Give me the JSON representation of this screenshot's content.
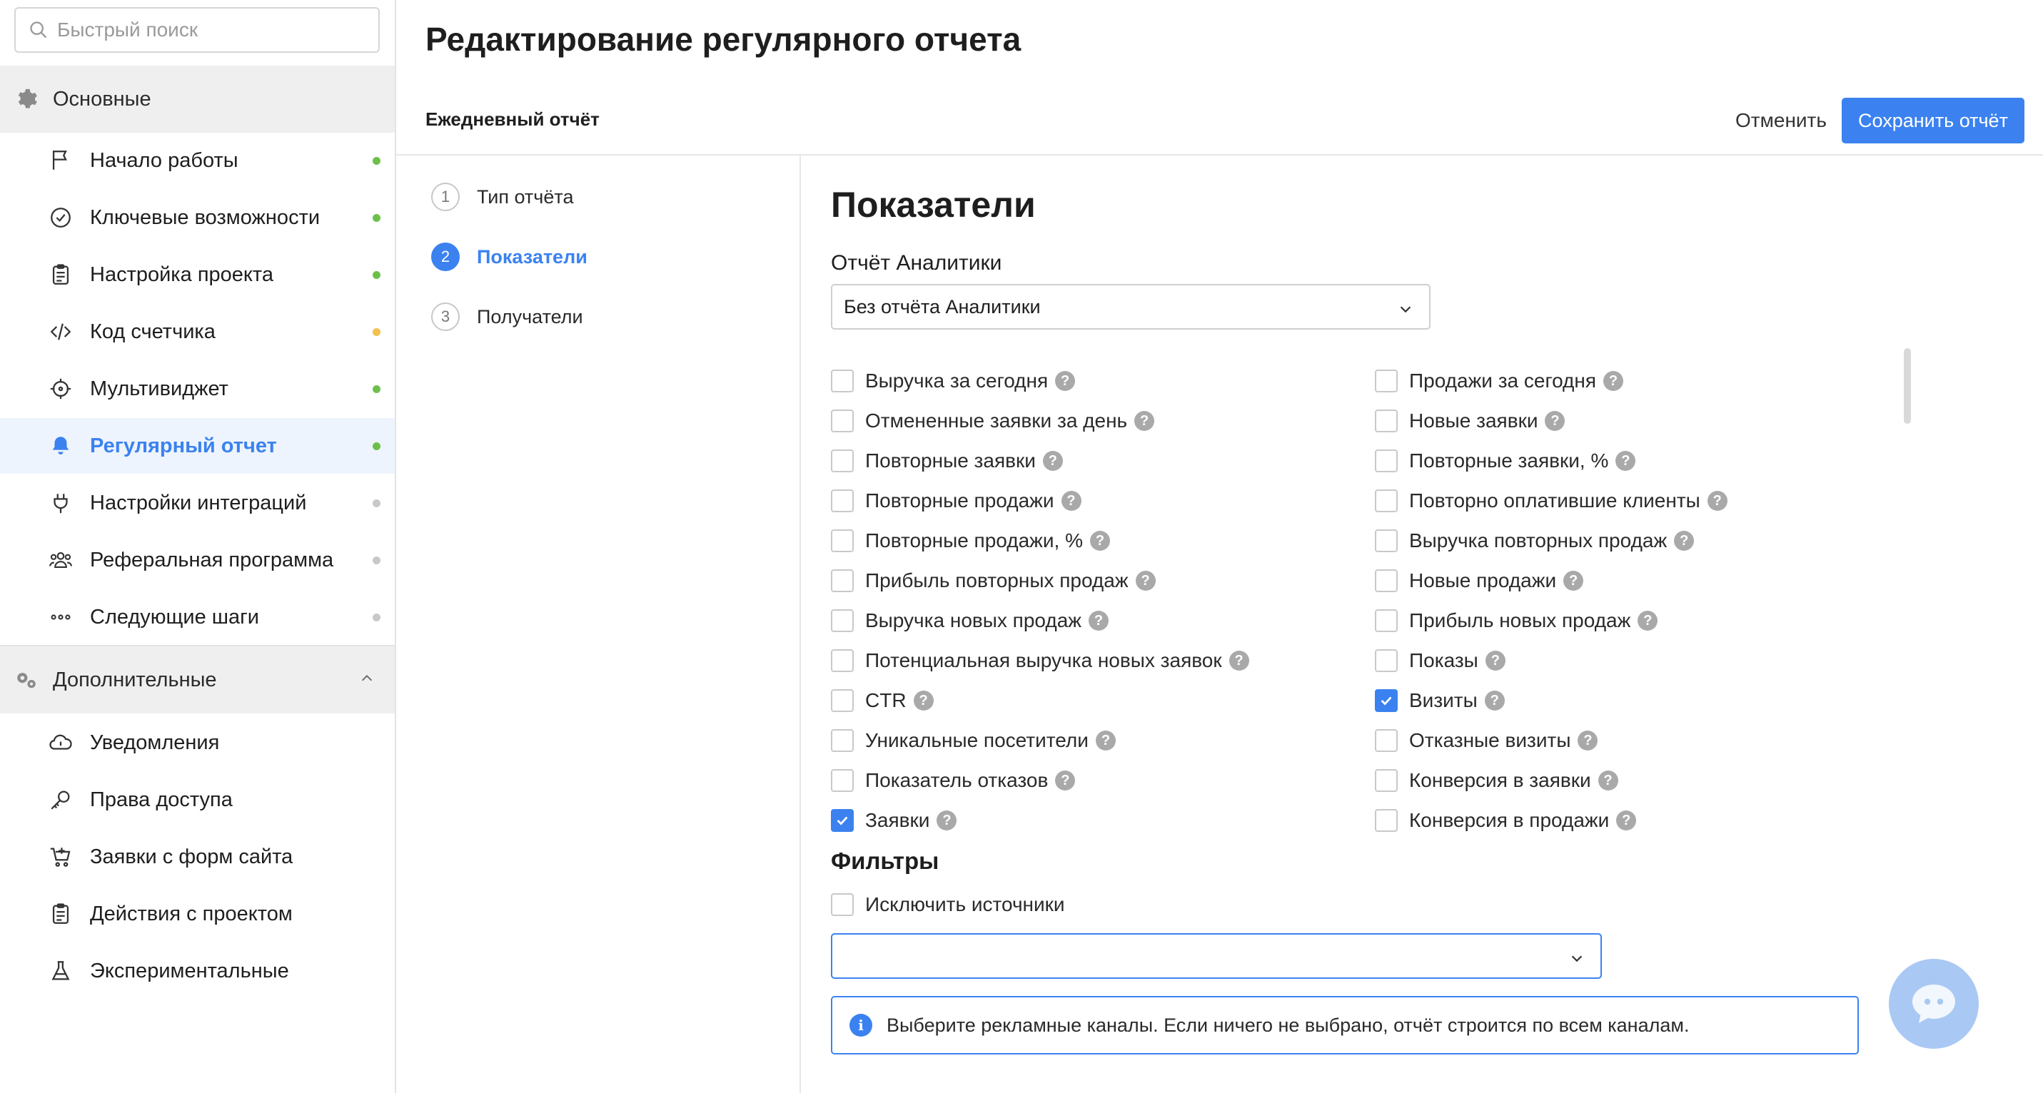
{
  "search": {
    "placeholder": "Быстрый поиск"
  },
  "sidebar": {
    "main_section": {
      "label": "Основные"
    },
    "main_items": [
      {
        "label": "Начало работы",
        "icon": "flag-icon",
        "status": "#6cc04a"
      },
      {
        "label": "Ключевые возможности",
        "icon": "check-circle-icon",
        "status": "#6cc04a"
      },
      {
        "label": "Настройка проекта",
        "icon": "clipboard-icon",
        "status": "#6cc04a"
      },
      {
        "label": "Код счетчика",
        "icon": "code-icon",
        "status": "#f2c14e"
      },
      {
        "label": "Мультивиджет",
        "icon": "crosshair-icon",
        "status": "#6cc04a"
      },
      {
        "label": "Регулярный отчет",
        "icon": "bell-icon",
        "status": "#6cc04a",
        "active": true
      },
      {
        "label": "Настройки интеграций",
        "icon": "plug-icon",
        "status": "#c8c8c8"
      },
      {
        "label": "Реферальная программа",
        "icon": "users-icon",
        "status": "#c8c8c8"
      },
      {
        "label": "Следующие шаги",
        "icon": "dots-icon",
        "status": "#c8c8c8"
      }
    ],
    "extra_section": {
      "label": "Дополнительные"
    },
    "extra_items": [
      {
        "label": "Уведомления",
        "icon": "cloud-icon"
      },
      {
        "label": "Права доступа",
        "icon": "key-icon"
      },
      {
        "label": "Заявки с форм сайта",
        "icon": "cart-icon"
      },
      {
        "label": "Действия с проектом",
        "icon": "clipboard-icon"
      },
      {
        "label": "Экспериментальные",
        "icon": "flask-icon"
      }
    ]
  },
  "header": {
    "title": "Редактирование регулярного отчета",
    "report_name": "Ежедневный отчёт",
    "cancel_label": "Отменить",
    "save_label": "Сохранить отчёт"
  },
  "steps": [
    {
      "num": "1",
      "label": "Тип отчёта"
    },
    {
      "num": "2",
      "label": "Показатели",
      "active": true
    },
    {
      "num": "3",
      "label": "Получатели"
    }
  ],
  "metrics_section": {
    "title": "Показатели",
    "analytics_label": "Отчёт Аналитики",
    "analytics_value": "Без отчёта Аналитики",
    "left": [
      {
        "label": "Выручка за сегодня",
        "checked": false
      },
      {
        "label": "Отмененные заявки за день",
        "checked": false
      },
      {
        "label": "Повторные заявки",
        "checked": false
      },
      {
        "label": "Повторные продажи",
        "checked": false
      },
      {
        "label": "Повторные продажи, %",
        "checked": false
      },
      {
        "label": "Прибыль повторных продаж",
        "checked": false
      },
      {
        "label": "Выручка новых продаж",
        "checked": false
      },
      {
        "label": "Потенциальная выручка новых заявок",
        "checked": false
      },
      {
        "label": "CTR",
        "checked": false
      },
      {
        "label": "Уникальные посетители",
        "checked": false
      },
      {
        "label": "Показатель отказов",
        "checked": false
      },
      {
        "label": "Заявки",
        "checked": true
      }
    ],
    "right": [
      {
        "label": "Продажи за сегодня",
        "checked": false
      },
      {
        "label": "Новые заявки",
        "checked": false
      },
      {
        "label": "Повторные заявки, %",
        "checked": false
      },
      {
        "label": "Повторно оплатившие клиенты",
        "checked": false
      },
      {
        "label": "Выручка повторных продаж",
        "checked": false
      },
      {
        "label": "Новые продажи",
        "checked": false
      },
      {
        "label": "Прибыль новых продаж",
        "checked": false
      },
      {
        "label": "Показы",
        "checked": false
      },
      {
        "label": "Визиты",
        "checked": true
      },
      {
        "label": "Отказные визиты",
        "checked": false
      },
      {
        "label": "Конверсия в заявки",
        "checked": false
      },
      {
        "label": "Конверсия в продажи",
        "checked": false
      }
    ],
    "help_glyph": "?"
  },
  "filters": {
    "title": "Фильтры",
    "exclude_label": "Исключить источники",
    "exclude_checked": false,
    "channels_value": "",
    "info_glyph": "i",
    "info_text": "Выберите рекламные каналы. Если ничего не выбрано, отчёт строится по всем каналам."
  },
  "colors": {
    "accent": "#3b82f0",
    "chat": "#a9c8f4"
  }
}
